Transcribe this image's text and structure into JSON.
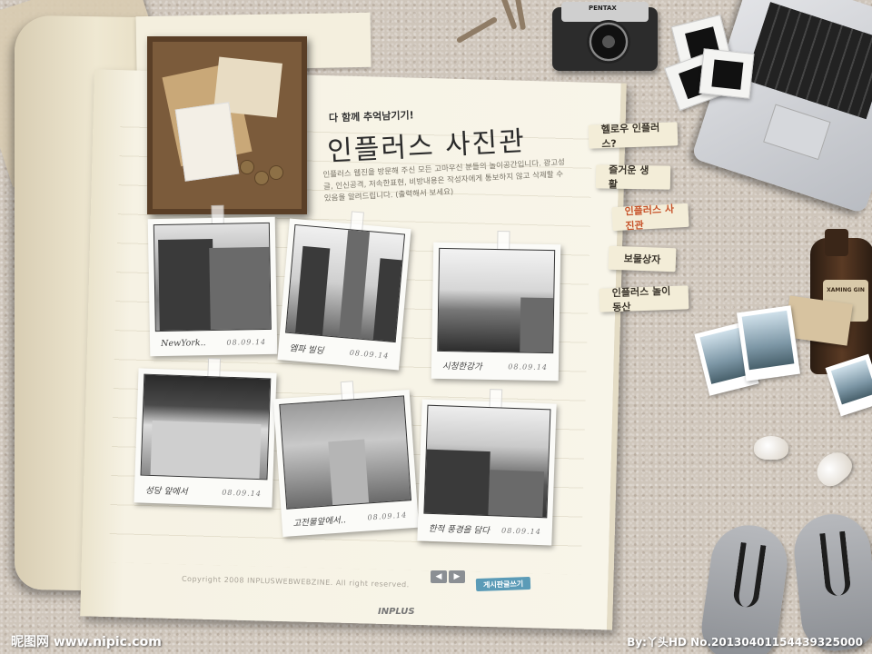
{
  "header": {
    "subtitle": "다 함께 추억남기기!",
    "title": "인플러스 사진관",
    "intro": "인플러스 웹진을 방문해 주신 모든 고마우신 분들의 놀이공간입니다. 광고성 글, 인신공격, 저속한표현, 비방내용은 작성자에게 통보하지 않고 삭제할 수 있음을 알려드립니다. (출력해서 보세요)"
  },
  "nav": {
    "items": [
      {
        "label": "헬로우 인플러스?",
        "active": false
      },
      {
        "label": "즐거운 생활",
        "active": false
      },
      {
        "label": "인플러스 사진관",
        "active": true
      },
      {
        "label": "보물상자",
        "active": false
      },
      {
        "label": "인플러스 놀이동산",
        "active": false
      }
    ]
  },
  "photos": [
    {
      "caption": "NewYork..",
      "date": "08.09.14"
    },
    {
      "caption": "엠파 빌딩",
      "date": "08.09.14"
    },
    {
      "caption": "시청한강가",
      "date": "08.09.14"
    },
    {
      "caption": "성당 앞에서",
      "date": "08.09.14"
    },
    {
      "caption": "고전물앞에서..",
      "date": "08.09.14"
    },
    {
      "caption": "한적 풍경을 담다",
      "date": "08.09.14"
    }
  ],
  "controls": {
    "prev": "◀",
    "next": "▶",
    "write": "게시판글쓰기"
  },
  "footer": {
    "copyright": "Copyright 2008 INPLUSWEBWEBZINE. All right reserved.",
    "brand": "INPLUS"
  },
  "props": {
    "camera_label": "PENTAX",
    "bottle_label": "XAMING GIN"
  },
  "watermark": {
    "left": "昵图网 www.nipic.com",
    "right": "By:丫头HD  No.20130401154439325000"
  }
}
